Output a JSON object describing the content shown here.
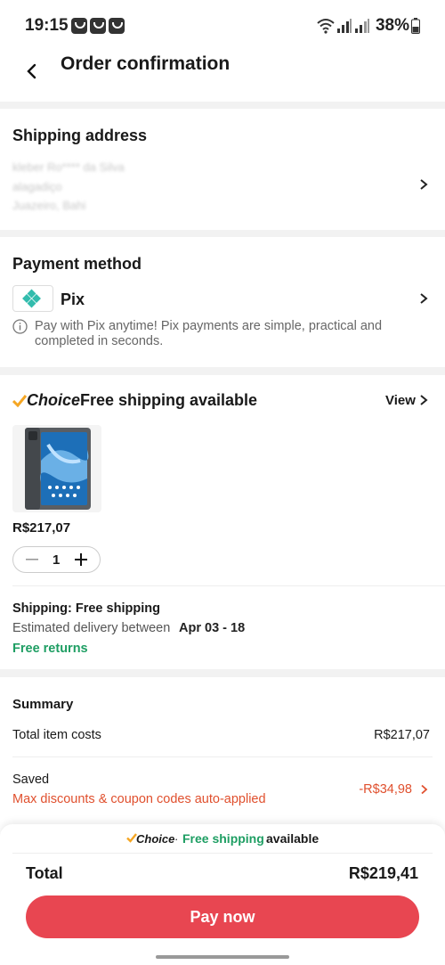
{
  "status_bar": {
    "time": "19:15",
    "battery": "38%"
  },
  "header": {
    "title": "Order confirmation"
  },
  "shipping_address": {
    "title": "Shipping address",
    "lines": [
      "kleber Ro**** da Silva",
      "alagadiço",
      "Juazeiro, Bahi"
    ]
  },
  "payment": {
    "title": "Payment method",
    "method": "Pix",
    "info": "Pay with Pix anytime! Pix payments are simple, practical and completed in seconds."
  },
  "choice": {
    "brand": "Choice",
    "label": "Free shipping available",
    "view": "View"
  },
  "product": {
    "price": "R$217,07",
    "quantity": "1"
  },
  "shipping_info": {
    "shipping_label": "Shipping: Free shipping",
    "delivery_prefix": "Estimated delivery between",
    "delivery_dates": "Apr 03 - 18",
    "returns": "Free returns"
  },
  "summary": {
    "title": "Summary",
    "total_item_label": "Total item costs",
    "total_item_value": "R$217,07",
    "saved_label": "Saved",
    "saved_note": "Max discounts & coupon codes auto-applied",
    "saved_value": "-R$34,98"
  },
  "banner": {
    "brand": "Choice",
    "separator": "·",
    "free_shipping": "Free shipping",
    "available": "available"
  },
  "footer": {
    "total_label": "Total",
    "total_value": "R$219,41",
    "pay_button": "Pay now"
  },
  "colors": {
    "accent": "#e84651",
    "green": "#1e9e63",
    "red": "#e0502e",
    "choice_check": "#f5a623"
  }
}
